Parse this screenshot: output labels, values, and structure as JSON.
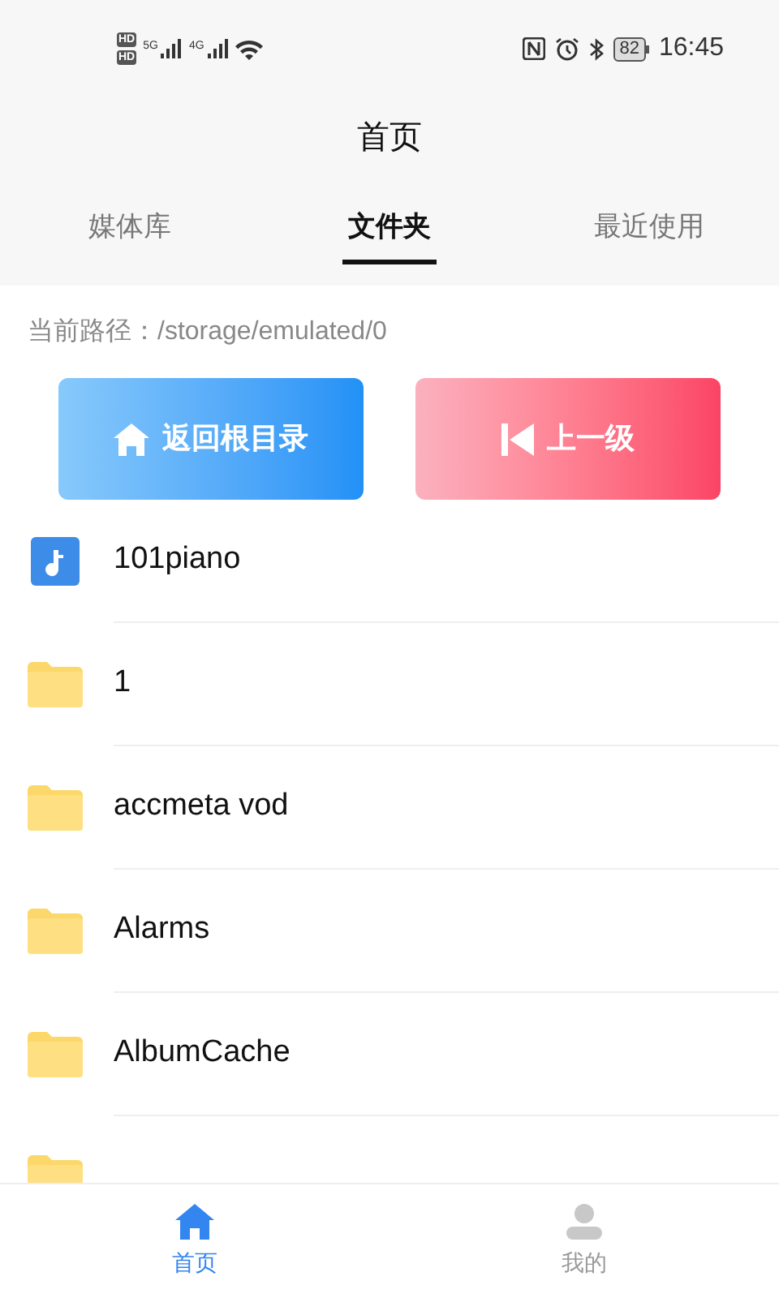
{
  "status_bar": {
    "hd_badges": [
      "HD",
      "HD"
    ],
    "networks": [
      "5G",
      "4G"
    ],
    "battery": "82",
    "time": "16:45"
  },
  "header": {
    "title": "首页"
  },
  "tabs": [
    {
      "label": "媒体库",
      "selected": false
    },
    {
      "label": "文件夹",
      "selected": true
    },
    {
      "label": "最近使用",
      "selected": false
    }
  ],
  "path": {
    "label": "当前路径：",
    "value": "/storage/emulated/0"
  },
  "buttons": [
    {
      "kind": "home",
      "label": "返回根目录"
    },
    {
      "kind": "up",
      "label": "上一级"
    }
  ],
  "files": [
    {
      "kind": "audio",
      "name": "101piano"
    },
    {
      "kind": "folder",
      "name": "1"
    },
    {
      "kind": "folder",
      "name": "accmeta vod"
    },
    {
      "kind": "folder",
      "name": "Alarms"
    },
    {
      "kind": "folder",
      "name": "AlbumCache"
    },
    {
      "kind": "folder"
    }
  ],
  "bottom_nav": [
    {
      "kind": "home",
      "label": "首页",
      "selected": true
    },
    {
      "kind": "profile",
      "label": "我的",
      "selected": false
    }
  ]
}
